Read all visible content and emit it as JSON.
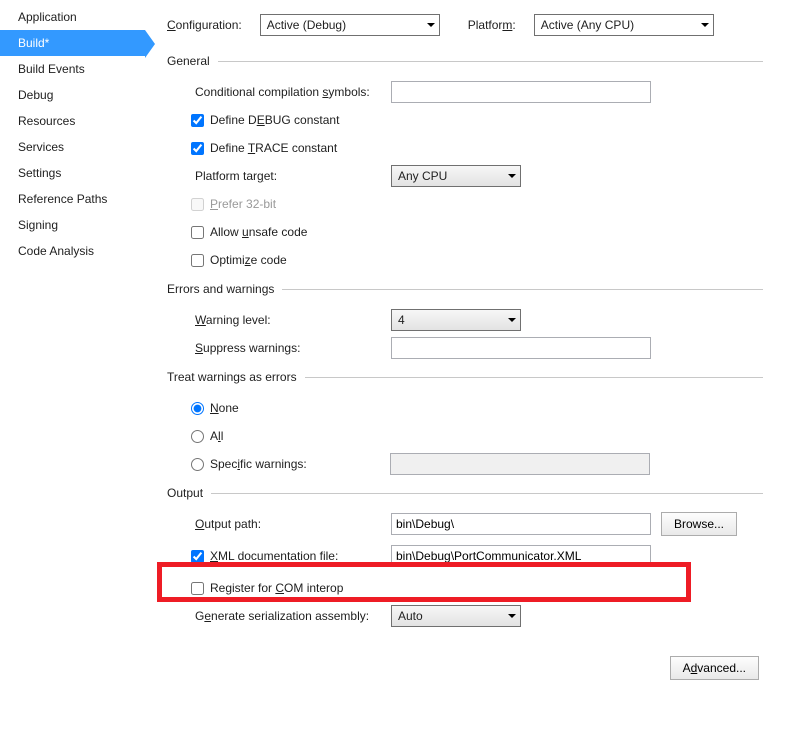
{
  "sidebar": {
    "items": [
      {
        "label": "Application"
      },
      {
        "label": "Build*"
      },
      {
        "label": "Build Events"
      },
      {
        "label": "Debug"
      },
      {
        "label": "Resources"
      },
      {
        "label": "Services"
      },
      {
        "label": "Settings"
      },
      {
        "label": "Reference Paths"
      },
      {
        "label": "Signing"
      },
      {
        "label": "Code Analysis"
      }
    ]
  },
  "top": {
    "config_label": "Configuration:",
    "config_value": "Active (Debug)",
    "platform_label": "Platform:",
    "platform_value": "Active (Any CPU)"
  },
  "general": {
    "header": "General",
    "cond_symbols_label": "Conditional compilation symbols:",
    "cond_symbols_value": "",
    "define_debug": "Define DEBUG constant",
    "define_trace": "Define TRACE constant",
    "platform_target_label": "Platform target:",
    "platform_target_value": "Any CPU",
    "prefer32": "Prefer 32-bit",
    "allow_unsafe": "Allow unsafe code",
    "optimize": "Optimize code"
  },
  "errors": {
    "header": "Errors and warnings",
    "warning_level_label": "Warning level:",
    "warning_level_value": "4",
    "suppress_label": "Suppress warnings:",
    "suppress_value": ""
  },
  "treat": {
    "header": "Treat warnings as errors",
    "none": "None",
    "all": "All",
    "specific": "Specific warnings:",
    "specific_value": ""
  },
  "output": {
    "header": "Output",
    "path_label": "Output path:",
    "path_value": "bin\\Debug\\",
    "browse": "Browse...",
    "xml_label": "XML documentation file:",
    "xml_value": "bin\\Debug\\PortCommunicator.XML",
    "register_com": "Register for COM interop",
    "serialize_label": "Generate serialization assembly:",
    "serialize_value": "Auto",
    "advanced": "Advanced..."
  }
}
